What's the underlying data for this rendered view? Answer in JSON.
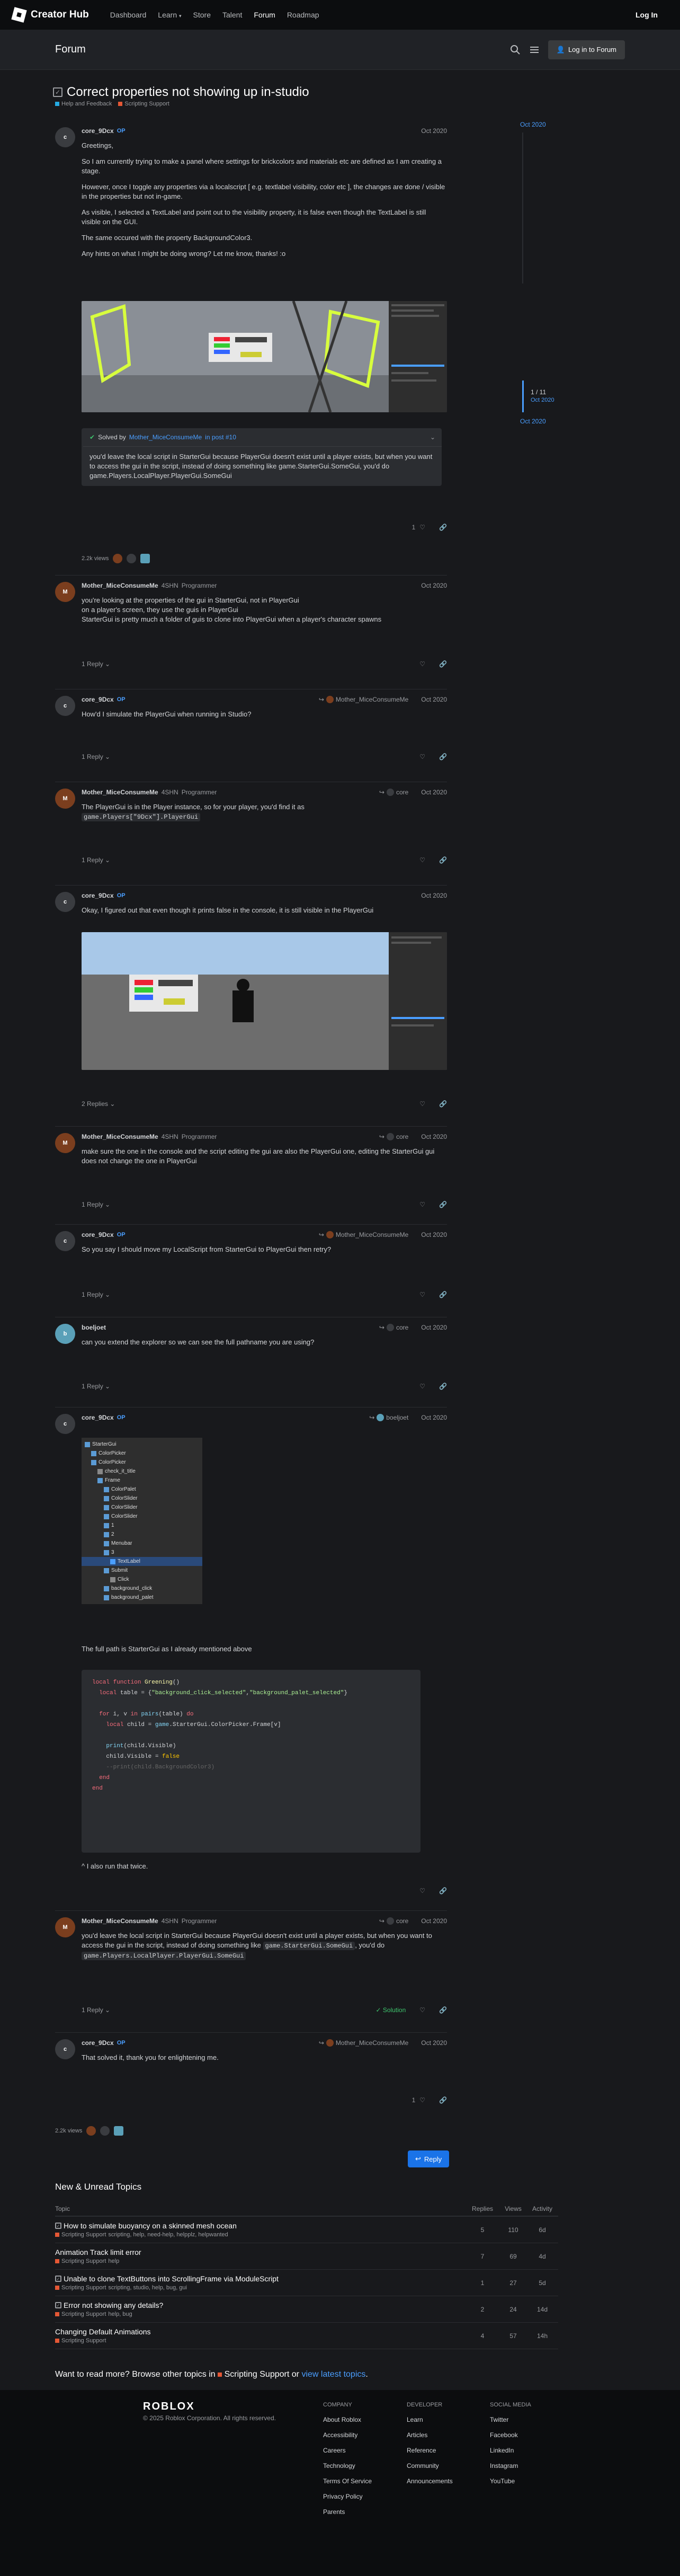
{
  "topbar": {
    "brand": "Creator Hub",
    "nav": [
      "Dashboard",
      "Learn",
      "Store",
      "Talent",
      "Forum",
      "Roadmap"
    ],
    "active": "Forum",
    "login": "Log In"
  },
  "forumbar": {
    "title": "Forum",
    "login_button": "Log in to Forum"
  },
  "topic": {
    "title": "Correct properties not showing up in-studio",
    "categories": [
      {
        "name": "Help and Feedback",
        "color": "#25aae2"
      },
      {
        "name": "Scripting Support",
        "color": "#e45735"
      }
    ]
  },
  "timeline": {
    "top_date": "Oct 2020",
    "position": "1 / 11",
    "position_date": "Oct 2020",
    "bottom_date": "Oct 2020"
  },
  "posts": [
    {
      "author": "core_9Dcx",
      "op": "OP",
      "date": "Oct 2020",
      "paragraphs": [
        "Greetings,",
        "So I am currently trying to make a panel where settings for brickcolors and materials etc are defined as I am creating a stage.",
        "However, once I toggle any properties via a localscript [ e.g. textlabel visibility, color etc ], the changes are done / visible in the properties but not in-game.",
        "As visible, I selected a TextLabel and point out to the visibility property, it is false even though the TextLabel is still visible on the GUI.",
        "The same occured with the property BackgroundColor3.",
        "Any hints on what I might be doing wrong? Let me know, thanks! :o"
      ],
      "solved": {
        "prefix": "Solved by",
        "by": "Mother_MiceConsumeMe",
        "in_post": "in post #10",
        "text": "you'd leave the local script in StarterGui because PlayerGui doesn't exist until a player exists, but when you want to access the gui in the script, instead of doing something like game.StarterGui.SomeGui, you'd do game.Players.LocalPlayer.PlayerGui.SomeGui"
      },
      "likes": "1",
      "views": "2.2k views"
    },
    {
      "author": "Mother_MiceConsumeMe",
      "badge": "4SHN",
      "role": "Programmer",
      "date": "Oct 2020",
      "text": "you're looking at the properties of the gui in StarterGui, not in PlayerGui",
      "text2": "on a player's screen, they use the guis in PlayerGui",
      "text3": "StarterGui is pretty much a folder of guis to clone into PlayerGui when a player's character spawns",
      "reply_label": "1 Reply"
    },
    {
      "author": "core_9Dcx",
      "op": "OP",
      "reply_to": "Mother_MiceConsumeMe",
      "date": "Oct 2020",
      "text": "How'd I simulate the PlayerGui when running in Studio?",
      "reply_label": "1 Reply"
    },
    {
      "author": "Mother_MiceConsumeMe",
      "badge": "4SHN",
      "role": "Programmer",
      "reply_to": "core",
      "date": "Oct 2020",
      "text": "The PlayerGui is in the Player instance, so for your player, you'd find it as",
      "code": "game.Players[\"9Dcx\"].PlayerGui",
      "reply_label": "1 Reply"
    },
    {
      "author": "core_9Dcx",
      "op": "OP",
      "date": "Oct 2020",
      "text": "Okay, I figured out that even though it prints false in the console, it is still visible in the PlayerGui",
      "reply_label": "2 Replies"
    },
    {
      "author": "Mother_MiceConsumeMe",
      "badge": "4SHN",
      "role": "Programmer",
      "reply_to": "core",
      "date": "Oct 2020",
      "text": "make sure the one in the console and the script editing the gui are also the PlayerGui one, editing the StarterGui gui does not change the one in PlayerGui",
      "reply_label": "1 Reply"
    },
    {
      "author": "core_9Dcx",
      "op": "OP",
      "reply_to": "Mother_MiceConsumeMe",
      "date": "Oct 2020",
      "text": "So you say I should move my LocalScript from StarterGui to PlayerGui then retry?",
      "reply_label": "1 Reply"
    },
    {
      "author": "boeljoet",
      "reply_to": "core",
      "date": "Oct 2020",
      "text": "can you extend the explorer so we can see the full pathname you are using?",
      "reply_label": "1 Reply"
    },
    {
      "author": "core_9Dcx",
      "op": "OP",
      "reply_to": "boeljoet",
      "date": "Oct 2020",
      "text": "The full path is StarterGui as I already mentioned above",
      "text2": "^ I also run that twice."
    },
    {
      "author": "Mother_MiceConsumeMe",
      "badge": "4SHN",
      "role": "Programmer",
      "reply_to": "core",
      "date": "Oct 2020",
      "text": "you'd leave the local script in StarterGui because PlayerGui doesn't exist until a player exists, but when you want to access the gui in the script, instead of doing something like",
      "code1": "game.StarterGui.SomeGui",
      "mid": ", you'd do",
      "code2": "game.Players.LocalPlayer.PlayerGui.SomeGui",
      "reply_label": "1 Reply",
      "solution_label": "Solution"
    },
    {
      "author": "core_9Dcx",
      "op": "OP",
      "reply_to": "Mother_MiceConsumeMe",
      "date": "Oct 2020",
      "text": "That solved it, thank you for enlightening me.",
      "likes": "1"
    }
  ],
  "explorer_tree": [
    "StarterGui",
    "ColorPicker",
    "ColorPicker",
    "check_it_title",
    "Frame",
    "ColorPalet",
    "ColorSlider",
    "ColorSlider",
    "ColorSlider",
    "1",
    "2",
    "Menubar",
    "3",
    "TextLabel",
    "Submit",
    "Click",
    "background_click",
    "background_palet"
  ],
  "code_lines": [
    "local function Greening()",
    "  local table = {\"background_click_selected\",\"background_palet_selected\"}",
    "",
    "  for i, v in pairs(table) do",
    "    local child = game.StarterGui.ColorPicker.Frame[v]",
    "",
    "    print(child.Visible)",
    "    child.Visible = false",
    "    --print(child.BackgroundColor3)",
    "  end",
    "end"
  ],
  "bottom_views": "2.2k views",
  "reply_button": "Reply",
  "new_unread": {
    "title": "New & Unread Topics",
    "headers": {
      "topic": "Topic",
      "replies": "Replies",
      "views": "Views",
      "activity": "Activity"
    },
    "rows": [
      {
        "title": "How to simulate buoyancy on a skinned mesh ocean",
        "category": "Scripting Support",
        "tags": "scripting, help, need-help, helpplz, helpwanted",
        "replies": "5",
        "views": "110",
        "activity": "6d",
        "checkbox": true
      },
      {
        "title": "Animation Track limit error",
        "category": "Scripting Support",
        "tags": "help",
        "replies": "7",
        "views": "69",
        "activity": "4d",
        "checkbox": false
      },
      {
        "title": "Unable to clone TextButtons into ScrollingFrame via ModuleScript",
        "category": "Scripting Support",
        "tags": "scripting, studio, help, bug, gui",
        "replies": "1",
        "views": "27",
        "activity": "5d",
        "checkbox": true
      },
      {
        "title": "Error not showing any details?",
        "category": "Scripting Support",
        "tags": "help, bug",
        "replies": "2",
        "views": "24",
        "activity": "14d",
        "checkbox": true
      },
      {
        "title": "Changing Default Animations",
        "category": "Scripting Support",
        "tags": "",
        "replies": "4",
        "views": "57",
        "activity": "14h",
        "checkbox": false
      }
    ]
  },
  "more": {
    "pre": "Want to read more? Browse other topics in",
    "category": "Scripting Support",
    "mid": "or",
    "link": "view latest topics",
    "end": "."
  },
  "footer": {
    "logo": "ROBLOX",
    "copyright": "© 2025 Roblox Corporation. All rights reserved.",
    "company": {
      "heading": "COMPANY",
      "links": [
        "About Roblox",
        "Accessibility",
        "Careers",
        "Technology",
        "Terms Of Service",
        "Privacy Policy",
        "Parents"
      ]
    },
    "developer": {
      "heading": "DEVELOPER",
      "links": [
        "Learn",
        "Articles",
        "Reference",
        "Community",
        "Announcements"
      ]
    },
    "social": {
      "heading": "SOCIAL MEDIA",
      "links": [
        "Twitter",
        "Facebook",
        "LinkedIn",
        "Instagram",
        "YouTube"
      ]
    }
  }
}
